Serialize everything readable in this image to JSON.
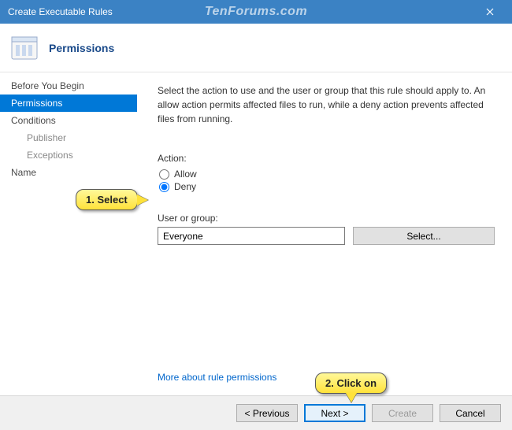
{
  "titlebar": {
    "title": "Create Executable Rules",
    "watermark": "TenForums.com"
  },
  "header": {
    "title": "Permissions"
  },
  "sidebar": {
    "items": [
      {
        "label": "Before You Begin"
      },
      {
        "label": "Permissions"
      },
      {
        "label": "Conditions"
      },
      {
        "label": "Publisher"
      },
      {
        "label": "Exceptions"
      },
      {
        "label": "Name"
      }
    ]
  },
  "main": {
    "description": "Select the action to use and the user or group that this rule should apply to. An allow action permits affected files to run, while a deny action prevents affected files from running.",
    "action_label": "Action:",
    "allow_label": "Allow",
    "deny_label": "Deny",
    "selected_action": "Deny",
    "user_group_label": "User or group:",
    "user_group_value": "Everyone",
    "select_button": "Select...",
    "more_link": "More about rule permissions"
  },
  "footer": {
    "previous": "< Previous",
    "next": "Next >",
    "create": "Create",
    "cancel": "Cancel"
  },
  "callouts": {
    "c1": "1. Select",
    "c2": "2. Click on"
  }
}
